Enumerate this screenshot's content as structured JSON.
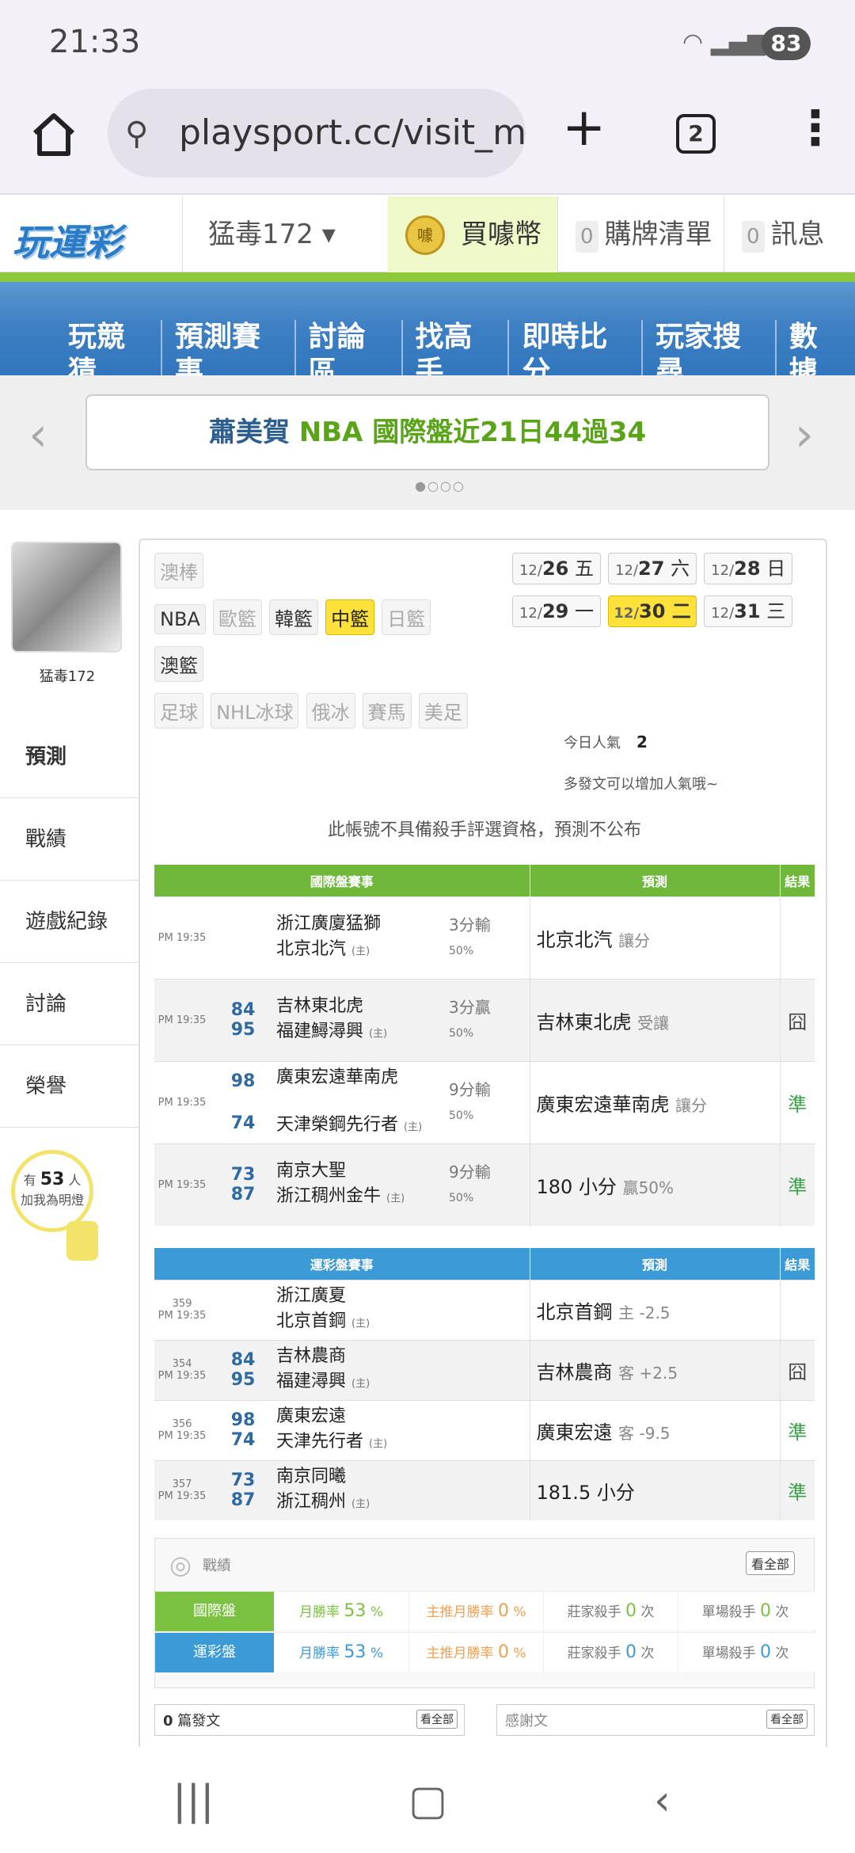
{
  "status": {
    "time": "21:33",
    "battery": "83"
  },
  "browser": {
    "url": "playsport.cc/visit_me",
    "tab_count": "2"
  },
  "site": {
    "logo": "玩運彩",
    "user": "猛毒172 ▾",
    "buy": "買噱幣",
    "coin": "噱",
    "cart_count": "0",
    "cart": "購牌清單",
    "msg_count": "0",
    "msg": "訊息"
  },
  "nav": [
    "玩競猜",
    "預測賽事",
    "討論區",
    "找高手",
    "即時比分",
    "玩家搜尋",
    "數據"
  ],
  "banner": {
    "name": "蕭美賀",
    "text": "NBA 國際盤近21日44過34"
  },
  "profile": {
    "name": "猛毒172",
    "fans_pre": "有",
    "fans": "53",
    "fans_unit": "人",
    "fans_cta": "加我為明燈"
  },
  "left_nav": [
    "預測",
    "戰績",
    "遊戲紀錄",
    "討論",
    "榮譽"
  ],
  "sports": {
    "row1": [
      "澳棒"
    ],
    "row2": [
      "NBA",
      "歐籃",
      "韓籃",
      "中籃",
      "日籃"
    ],
    "row3": [
      "澳籃"
    ],
    "row4": [
      "足球",
      "NHL冰球",
      "俄冰",
      "賽馬",
      "美足"
    ]
  },
  "dates": [
    {
      "md": "12/",
      "d": "26",
      "w": "五"
    },
    {
      "md": "12/",
      "d": "27",
      "w": "六"
    },
    {
      "md": "12/",
      "d": "28",
      "w": "日"
    },
    {
      "md": "12/",
      "d": "29",
      "w": "一"
    },
    {
      "md": "12/",
      "d": "30",
      "w": "二"
    },
    {
      "md": "12/",
      "d": "31",
      "w": "三"
    }
  ],
  "popularity": {
    "label": "今日人氣",
    "value": "2",
    "hint": "多發文可以增加人氣哦~"
  },
  "notice": "此帳號不具備殺手評選資格，預測不公布",
  "intl": {
    "h1": "國際盤賽事",
    "h2": "預測",
    "h3": "結果",
    "rows": [
      {
        "time": "PM 19:35",
        "s1": "",
        "s2": "",
        "t1": "浙江廣廈猛獅",
        "t2": "北京北汽",
        "home": "(主)",
        "odds": "3分輸",
        "pct": "50%",
        "pick": "北京北汽",
        "pick_note": "讓分",
        "res": ""
      },
      {
        "time": "PM 19:35",
        "s1": "84",
        "s2": "95",
        "t1": "吉林東北虎",
        "t2": "福建鱘潯興",
        "home": "(主)",
        "odds": "3分贏",
        "pct": "50%",
        "pick": "吉林東北虎",
        "pick_note": "受讓",
        "res": "囧"
      },
      {
        "time": "PM 19:35",
        "s1": "98",
        "s2": "74",
        "t1": "廣東宏遠華南虎",
        "t2": "天津榮鋼先行者",
        "home": "(主)",
        "odds": "9分輸",
        "pct": "50%",
        "pick": "廣東宏遠華南虎",
        "pick_note": "讓分",
        "res": "準"
      },
      {
        "time": "PM 19:35",
        "s1": "73",
        "s2": "87",
        "t1": "南京大聖",
        "t2": "浙江稠州金牛",
        "home": "(主)",
        "odds": "9分輸",
        "pct": "50%",
        "pick": "180 小分",
        "pick_note": "贏50%",
        "res": "準"
      }
    ]
  },
  "lottery": {
    "h1": "運彩盤賽事",
    "h2": "預測",
    "h3": "結果",
    "rows": [
      {
        "no": "359",
        "time": "PM 19:35",
        "s1": "",
        "s2": "",
        "t1": "浙江廣夏",
        "t2": "北京首鋼",
        "home": "(主)",
        "pick": "北京首鋼",
        "pick_note": "主 -2.5",
        "res": ""
      },
      {
        "no": "354",
        "time": "PM 19:35",
        "s1": "84",
        "s2": "95",
        "t1": "吉林農商",
        "t2": "福建潯興",
        "home": "(主)",
        "pick": "吉林農商",
        "pick_note": "客 +2.5",
        "res": "囧"
      },
      {
        "no": "356",
        "time": "PM 19:35",
        "s1": "98",
        "s2": "74",
        "t1": "廣東宏遠",
        "t2": "天津先行者",
        "home": "(主)",
        "pick": "廣東宏遠",
        "pick_note": "客 -9.5",
        "res": "準"
      },
      {
        "no": "357",
        "time": "PM 19:35",
        "s1": "73",
        "s2": "87",
        "t1": "南京同曦",
        "t2": "浙江稠州",
        "home": "(主)",
        "pick": "181.5 小分",
        "pick_note": "",
        "res": "準"
      }
    ]
  },
  "record": {
    "title": "戰績",
    "all": "看全部",
    "rows": [
      {
        "tag": "國際盤",
        "month": "月勝率",
        "month_v": "53",
        "main": "主推月勝率",
        "main_v": "0",
        "killer": "莊家殺手",
        "killer_v": "0",
        "single": "單場殺手",
        "single_v": "0",
        "pct": "%",
        "times": "次"
      },
      {
        "tag": "運彩盤",
        "month": "月勝率",
        "month_v": "53",
        "main": "主推月勝率",
        "main_v": "0",
        "killer": "莊家殺手",
        "killer_v": "0",
        "single": "單場殺手",
        "single_v": "0",
        "pct": "%",
        "times": "次"
      }
    ]
  },
  "posts": {
    "count": "0",
    "label": "篇發文",
    "all": "看全部",
    "thanks": "感謝文",
    "all2": "看全部"
  },
  "colors": {
    "green": "#6fb83b",
    "blue": "#3c9ad6",
    "yellow": "#ffe13b"
  }
}
